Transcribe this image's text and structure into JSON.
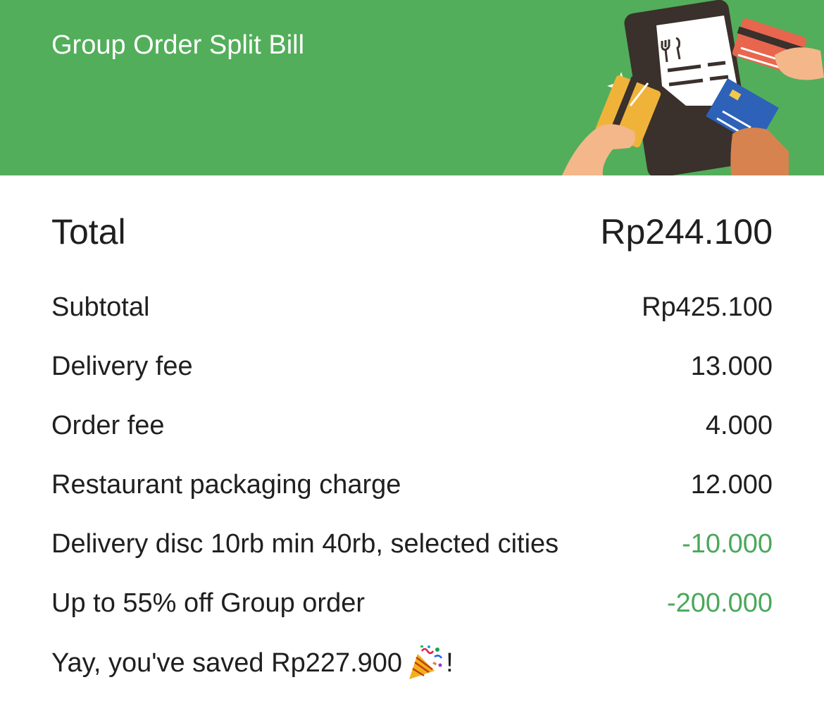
{
  "header": {
    "title": "Group Order Split Bill",
    "background_color": "#52ae5a",
    "illustration": "bill-split-cards-icon"
  },
  "total": {
    "label": "Total",
    "amount": "Rp244.100"
  },
  "line_items": [
    {
      "label": "Subtotal",
      "amount": "Rp425.100"
    },
    {
      "label": "Delivery fee",
      "amount": "13.000"
    },
    {
      "label": "Order fee",
      "amount": "4.000"
    },
    {
      "label": "Restaurant packaging charge",
      "amount": "12.000"
    },
    {
      "label": "Delivery disc 10rb min 40rb, selected cities",
      "amount": "-10.000"
    },
    {
      "label": "Up to 55% off Group order",
      "amount": "-200.000"
    }
  ],
  "discount_color": "#4aa85a",
  "savings": {
    "text": "Yay, you've saved Rp227.900",
    "icon": "party-popper-icon",
    "suffix": "!"
  }
}
